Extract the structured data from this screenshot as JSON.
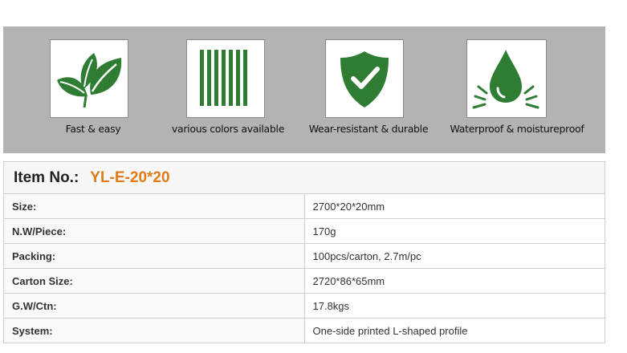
{
  "features": [
    {
      "icon": "leaves-icon",
      "caption": "Fast & easy"
    },
    {
      "icon": "color-stripes-icon",
      "caption": "various colors available"
    },
    {
      "icon": "shield-check-icon",
      "caption": "Wear-resistant & durable"
    },
    {
      "icon": "water-drop-icon",
      "caption": "Waterproof & moistureproof"
    }
  ],
  "colors": {
    "icon_green": "#2e7d32",
    "accent_orange": "#e07b1a",
    "band_gray": "#b3b3b3"
  },
  "spec": {
    "item_label": "Item No.:",
    "item_value": "YL-E-20*20",
    "rows": [
      {
        "label": "Size:",
        "value": "2700*20*20mm"
      },
      {
        "label": "N.W/Piece:",
        "value": "170g"
      },
      {
        "label": "Packing:",
        "value": "100pcs/carton, 2.7m/pc"
      },
      {
        "label": "Carton Size:",
        "value": "2720*86*65mm"
      },
      {
        "label": "G.W/Ctn:",
        "value": "17.8kgs"
      },
      {
        "label": "System:",
        "value": "One-side printed L-shaped profile"
      }
    ]
  }
}
